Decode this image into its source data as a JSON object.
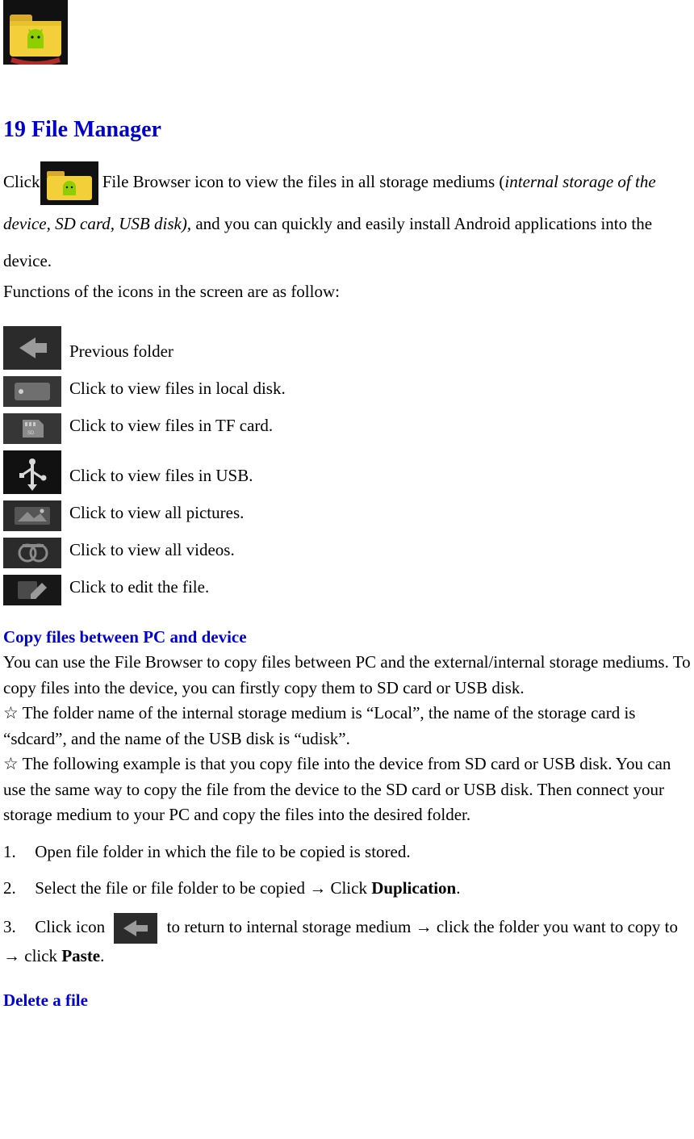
{
  "title": "19 File Manager",
  "intro": {
    "pre_icon": "Click",
    "after_icon": " File Browser icon to view the files in all storage mediums (",
    "italic_part": "internal storage of the device, SD card, USB disk),",
    "after_italic": " and you can quickly and easily install Android applications into the device."
  },
  "functions_heading": "Functions of the icons in the screen are as follow:",
  "icons": {
    "previous": "Previous folder",
    "local": "Click to view files in local disk.",
    "tf": "Click to view files in TF card.",
    "usb": "Click to view files in USB.",
    "pictures": "Click to view all pictures.",
    "videos": "Click to view all videos.",
    "edit": "Click to edit the file."
  },
  "copy_section": {
    "heading": "Copy files between PC and device",
    "p1": "You can use the File Browser to copy files between PC and the external/internal storage mediums. To copy files into the device, you can firstly copy them to SD card or USB disk.",
    "star1": "☆   The folder name of the internal storage medium is “Local”, the name of the storage card is “sdcard”, and the name of the USB disk is “udisk”.",
    "star2": "☆   The following example is that you copy file into the device from SD card or USB disk. You can use the same way to copy the file from the device to the SD card or USB disk. Then connect your storage medium to your PC and copy the files into the desired folder.",
    "step1_num": "1.",
    "step1": "Open file folder in which the file to be copied is stored.",
    "step2_num": "2.",
    "step2_pre": "Select the file or file folder to be copied → Click ",
    "step2_bold": "Duplication",
    "step2_post": ".",
    "step3_num": "3.",
    "step3_pre": "Click icon ",
    "step3_mid": " to return to internal storage medium → click the folder you want to copy to → click ",
    "step3_bold": "Paste",
    "step3_post": "."
  },
  "delete_heading": "Delete a file"
}
